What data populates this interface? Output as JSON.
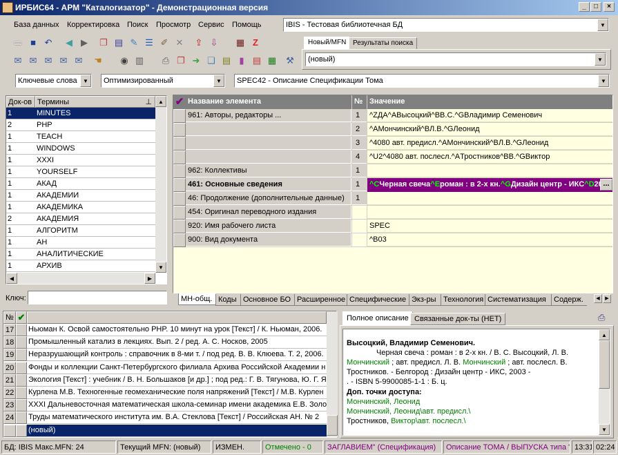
{
  "window": {
    "title": "ИРБИС64 - АРМ \"Каталогизатор\" - Демонстрационная версия"
  },
  "menu": [
    "База данных",
    "Корректировка",
    "Поиск",
    "Просмотр",
    "Сервис",
    "Помощь"
  ],
  "db_combo": {
    "value": "IBIS - Тестовая библиотечная БД"
  },
  "mfn_tabs": [
    "Новый/MFN",
    "Результаты поиска"
  ],
  "mfn_combo": {
    "value": "(новый)"
  },
  "search": {
    "mode": "Ключевые слова",
    "worklist": "Оптимизированный",
    "spec": "SPEC42 - Описание Спецификации Тома"
  },
  "terms": {
    "col_count": "Док-ов",
    "col_term": "Термины",
    "rows": [
      {
        "count": "1",
        "term": "MINUTES"
      },
      {
        "count": "2",
        "term": "PHP"
      },
      {
        "count": "1",
        "term": "TEACH"
      },
      {
        "count": "1",
        "term": "WINDOWS"
      },
      {
        "count": "1",
        "term": "XXXI"
      },
      {
        "count": "1",
        "term": "YOURSELF"
      },
      {
        "count": "1",
        "term": "АКАД"
      },
      {
        "count": "1",
        "term": "АКАДЕМИИ"
      },
      {
        "count": "1",
        "term": "АКАДЕМИКА"
      },
      {
        "count": "2",
        "term": "АКАДЕМИЯ"
      },
      {
        "count": "1",
        "term": "АЛГОРИТМ"
      },
      {
        "count": "1",
        "term": "АН"
      },
      {
        "count": "1",
        "term": "АНАЛИТИЧЕСКИЕ"
      },
      {
        "count": "1",
        "term": "АРХИВ"
      }
    ],
    "key_label": "Ключ:"
  },
  "fields": {
    "col_name": "Название элемента",
    "col_num": "№",
    "col_value": "Значение",
    "rows": [
      {
        "name": "961: Авторы, редакторы ...",
        "num": "1",
        "value": "^ZДА^AВысоцкий^BВ.С.^GВладимир Семенович"
      },
      {
        "name": "",
        "num": "2",
        "value": "^AМончинский^BЛ.В.^GЛеонид"
      },
      {
        "name": "",
        "num": "3",
        "value": "^4080 авт. предисл.^AМончинский^BЛ.В.^GЛеонид"
      },
      {
        "name": "",
        "num": "4",
        "value": "^U2^4080 авт. послесл.^AТростников^BВ.^GВиктор"
      },
      {
        "name": "962: Коллективы",
        "num": "1",
        "value": ""
      },
      {
        "name": "461: Основные сведения",
        "num": "1",
        "value": ""
      },
      {
        "name": "46: Продолжение (дополнительные данные)",
        "num": "1",
        "value": ""
      },
      {
        "name": "454: Оригинал переводного издания",
        "num": "",
        "value": ""
      },
      {
        "name": "920: Имя рабочего листа",
        "num": "",
        "value": "SPEC"
      },
      {
        "name": "900: Вид документа",
        "num": "",
        "value": "^B03"
      }
    ],
    "selected_value_parts": [
      {
        "t": "^C",
        "hl": true
      },
      {
        "t": "Черная свеча",
        "hl": false
      },
      {
        "t": "^E",
        "hl": true
      },
      {
        "t": "роман : в 2-х кн.",
        "hl": false
      },
      {
        "t": "^G",
        "hl": true
      },
      {
        "t": "Дизайн центр - ИКС",
        "hl": false
      },
      {
        "t": "^D",
        "hl": true
      },
      {
        "t": "20",
        "hl": false
      }
    ],
    "more_button": "..."
  },
  "bottom_tabs": [
    "МН-общ.",
    "Коды",
    "Основное БО",
    "Расширенное",
    "Специфические",
    "Экз-ры",
    "Технология",
    "Систематизация",
    "Содерж."
  ],
  "records": {
    "col_num": "№",
    "rows": [
      {
        "n": "17",
        "text": "Ньюман К. Освой самостоятельно PHP. 10 минут на урок [Текст] / К. Ньюман, 2006."
      },
      {
        "n": "18",
        "text": "Промышленный катализ в лекциях. Вып. 2 / ред. А. С. Носков, 2005"
      },
      {
        "n": "19",
        "text": "Неразрушающий контроль : справочник в 8-ми т. / под ред. В. В. Клюева. Т. 2, 2006."
      },
      {
        "n": "20",
        "text": "Фонды и коллекции Санкт-Петербургского филиала Архива Российской Академии н"
      },
      {
        "n": "21",
        "text": "Экология [Текст] : учебник / В. Н. Большаков [и др.] ; под ред.: Г. В. Тягунова, Ю. Г. Я"
      },
      {
        "n": "22",
        "text": "Курлена М.В. Техногенные геомеханические поля напряжений [Текст] / М.В. Курлен"
      },
      {
        "n": "23",
        "text": "XXXI Дальневосточная математическая школа-семинар имени академика Е.В. Золо"
      },
      {
        "n": "24",
        "text": "Труды математического института им. В.А. Стеклова [Текст] / Российская АН. № 2"
      },
      {
        "n": "",
        "text": "(новый)"
      }
    ]
  },
  "desc_tabs": [
    "Полное описание",
    "Связанные док-ты (НЕТ)"
  ],
  "description": {
    "author": "Высоцкий, Владимир Семенович.",
    "l1": "Черная свеча : роман : в 2-х кн. / В. С. Высоцкий, Л. В.",
    "l2a": "Мончинский",
    "l2b": "; авт. предисл. Л. В.",
    "l2c": "Мончинский",
    "l2d": "; авт. послесл. В.",
    "l3": "Тростников. - Белгород : Дизайн центр - ИКС, 2003 -",
    "l4": ". - ISBN 5-9900085-1-1 : Б. ц.",
    "access": "Доп. точки доступа:",
    "a1": "Мончинский, Леонид",
    "a2": "Мончинский, Леонид\\авт. предисл.\\",
    "a3a": "Тростников,",
    "a3b": "Виктор\\авт. послесл.\\"
  },
  "status": {
    "db": "БД: IBIS Макс.MFN: 24",
    "mfn": "Текущий MFN: (новый)",
    "changed": "ИЗМЕН.",
    "marked": "Отмечено - 0",
    "s5": "ЗАГЛАВИЕМ\" (Спецификация)",
    "s6": "Описание ТОМА / ВЫПУСКА типа \"",
    "time": "13:31",
    "time2": "02:24"
  },
  "colors": {
    "selection": "#0a246a",
    "yellow": "#ffffe1",
    "magenta_row": "#800080",
    "green_text": "#008000"
  }
}
